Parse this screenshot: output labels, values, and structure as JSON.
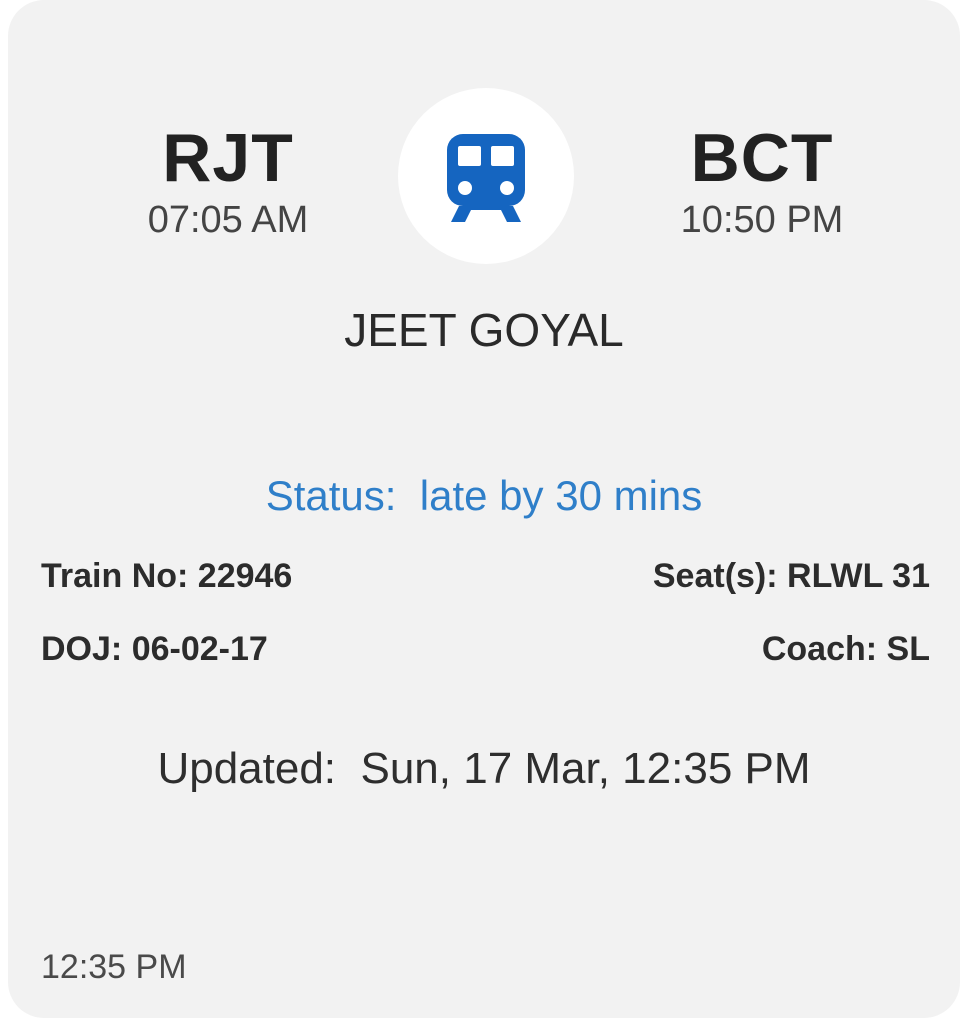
{
  "journey": {
    "from": {
      "code": "RJT",
      "time": "07:05 AM"
    },
    "to": {
      "code": "BCT",
      "time": "10:50 PM"
    },
    "icon": "train-icon",
    "icon_color": "#1565c0"
  },
  "passenger": {
    "name": "JEET GOYAL"
  },
  "status": {
    "label": "Status:",
    "value": "late by 30 mins",
    "color": "#2f7fc9"
  },
  "details": {
    "train_no_label": "Train No:",
    "train_no": "22946",
    "seats_label": "Seat(s):",
    "seats": "RLWL 31",
    "doj_label": "DOJ:",
    "doj": "06-02-17",
    "coach_label": "Coach:",
    "coach": "SL"
  },
  "updated": {
    "label": "Updated:",
    "value": "Sun, 17 Mar, 12:35 PM"
  },
  "footer": {
    "time": "12:35 PM"
  }
}
